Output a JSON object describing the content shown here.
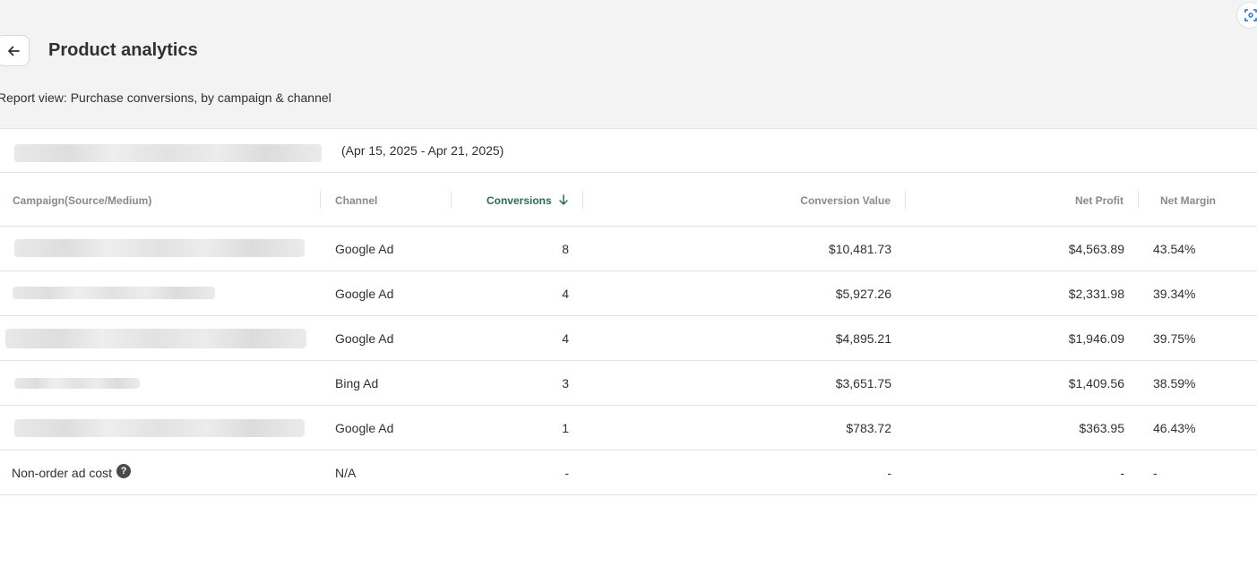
{
  "header": {
    "title": "Product analytics",
    "report_view": "Report view: Purchase conversions, by campaign & channel"
  },
  "filter": {
    "date_range": "(Apr 15, 2025 - Apr 21, 2025)"
  },
  "table": {
    "columns": {
      "campaign": "Campaign(Source/Medium)",
      "channel": "Channel",
      "conversions": "Conversions",
      "conversion_value": "Conversion Value",
      "net_profit": "Net Profit",
      "net_margin": "Net Margin"
    },
    "sort": {
      "column": "conversions",
      "direction": "descending"
    },
    "rows": [
      {
        "channel": "Google Ad",
        "conversions": "8",
        "conversion_value": "$10,481.73",
        "net_profit": "$4,563.89",
        "net_margin": "43.54%"
      },
      {
        "channel": "Google Ad",
        "conversions": "4",
        "conversion_value": "$5,927.26",
        "net_profit": "$2,331.98",
        "net_margin": "39.34%"
      },
      {
        "channel": "Google Ad",
        "conversions": "4",
        "conversion_value": "$4,895.21",
        "net_profit": "$1,946.09",
        "net_margin": "39.75%"
      },
      {
        "channel": "Bing Ad",
        "conversions": "3",
        "conversion_value": "$3,651.75",
        "net_profit": "$1,409.56",
        "net_margin": "38.59%"
      },
      {
        "channel": "Google Ad",
        "conversions": "1",
        "conversion_value": "$783.72",
        "net_profit": "$363.95",
        "net_margin": "46.43%"
      }
    ],
    "footer_row": {
      "campaign": "Non-order ad cost",
      "channel": "N/A",
      "conversions": "-",
      "conversion_value": "-",
      "net_profit": "-",
      "net_margin": "-"
    }
  },
  "icons": {
    "back": "arrow-left-icon",
    "sort": "arrow-down-icon",
    "help": "question-circle-icon",
    "corner": "screen-capture-icon"
  },
  "colors": {
    "active_header": "#2d6a4f",
    "muted_header": "#8a8a8a",
    "page_background": "#f3f3f3"
  }
}
